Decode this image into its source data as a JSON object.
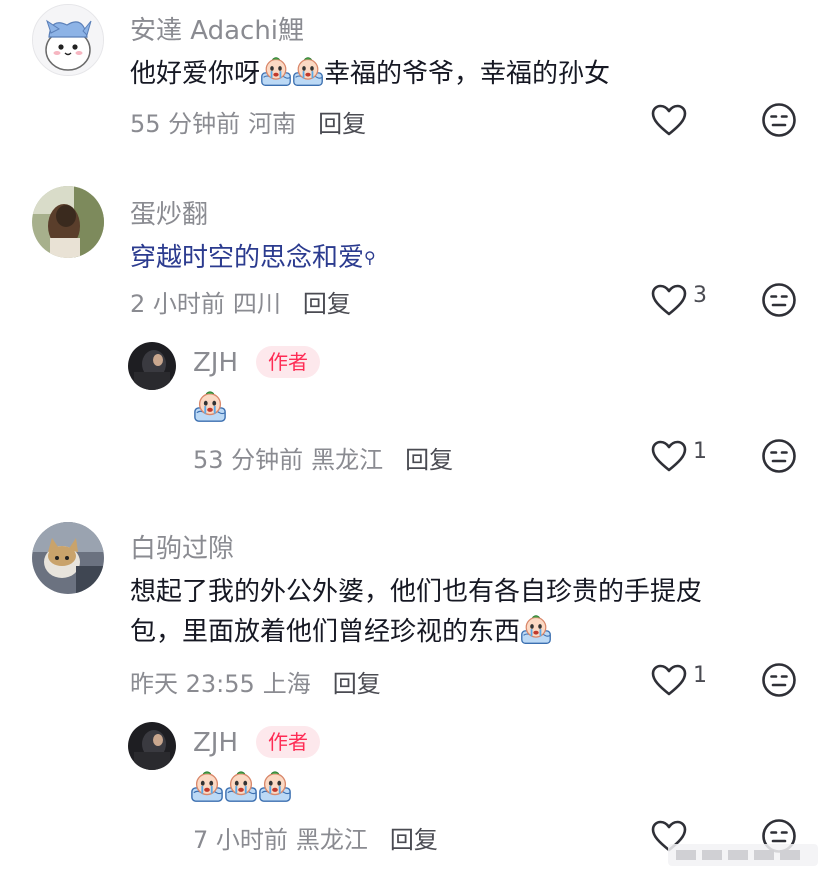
{
  "comments": [
    {
      "username": "安達 Adachi鯉",
      "text_prefix": "他好爱你呀",
      "text_suffix": "幸福的爷爷，幸福的孙女",
      "time": "55 分钟前",
      "location": "河南",
      "reply_label": "回复",
      "likes": ""
    },
    {
      "username": "蛋炒翻",
      "text": "穿越时空的思念和爱",
      "time": "2 小时前",
      "location": "四川",
      "reply_label": "回复",
      "likes": "3",
      "replies": [
        {
          "username": "ZJH",
          "badge": "作者",
          "time": "53 分钟前",
          "location": "黑龙江",
          "reply_label": "回复",
          "likes": "1"
        }
      ]
    },
    {
      "username": "白驹过隙",
      "text_line1": "想起了我的外公外婆，他们也有各自珍贵的手提皮",
      "text_line2": "包，里面放着他们曾经珍视的东西",
      "time": "昨天 23:55",
      "location": "上海",
      "reply_label": "回复",
      "likes": "1",
      "replies": [
        {
          "username": "ZJH",
          "badge": "作者",
          "time": "7 小时前",
          "location": "黑龙江",
          "reply_label": "回复",
          "likes": ""
        }
      ]
    }
  ],
  "icons": {
    "like": "heart-outline-icon",
    "dislike": "neutral-face-icon",
    "emoji": "crying-baby-emoji"
  },
  "colors": {
    "username": "#8a8b91",
    "text": "#161823",
    "badge_bg": "#fde8ec",
    "badge_text": "#fe2c55",
    "link": "#2b3b8f"
  }
}
